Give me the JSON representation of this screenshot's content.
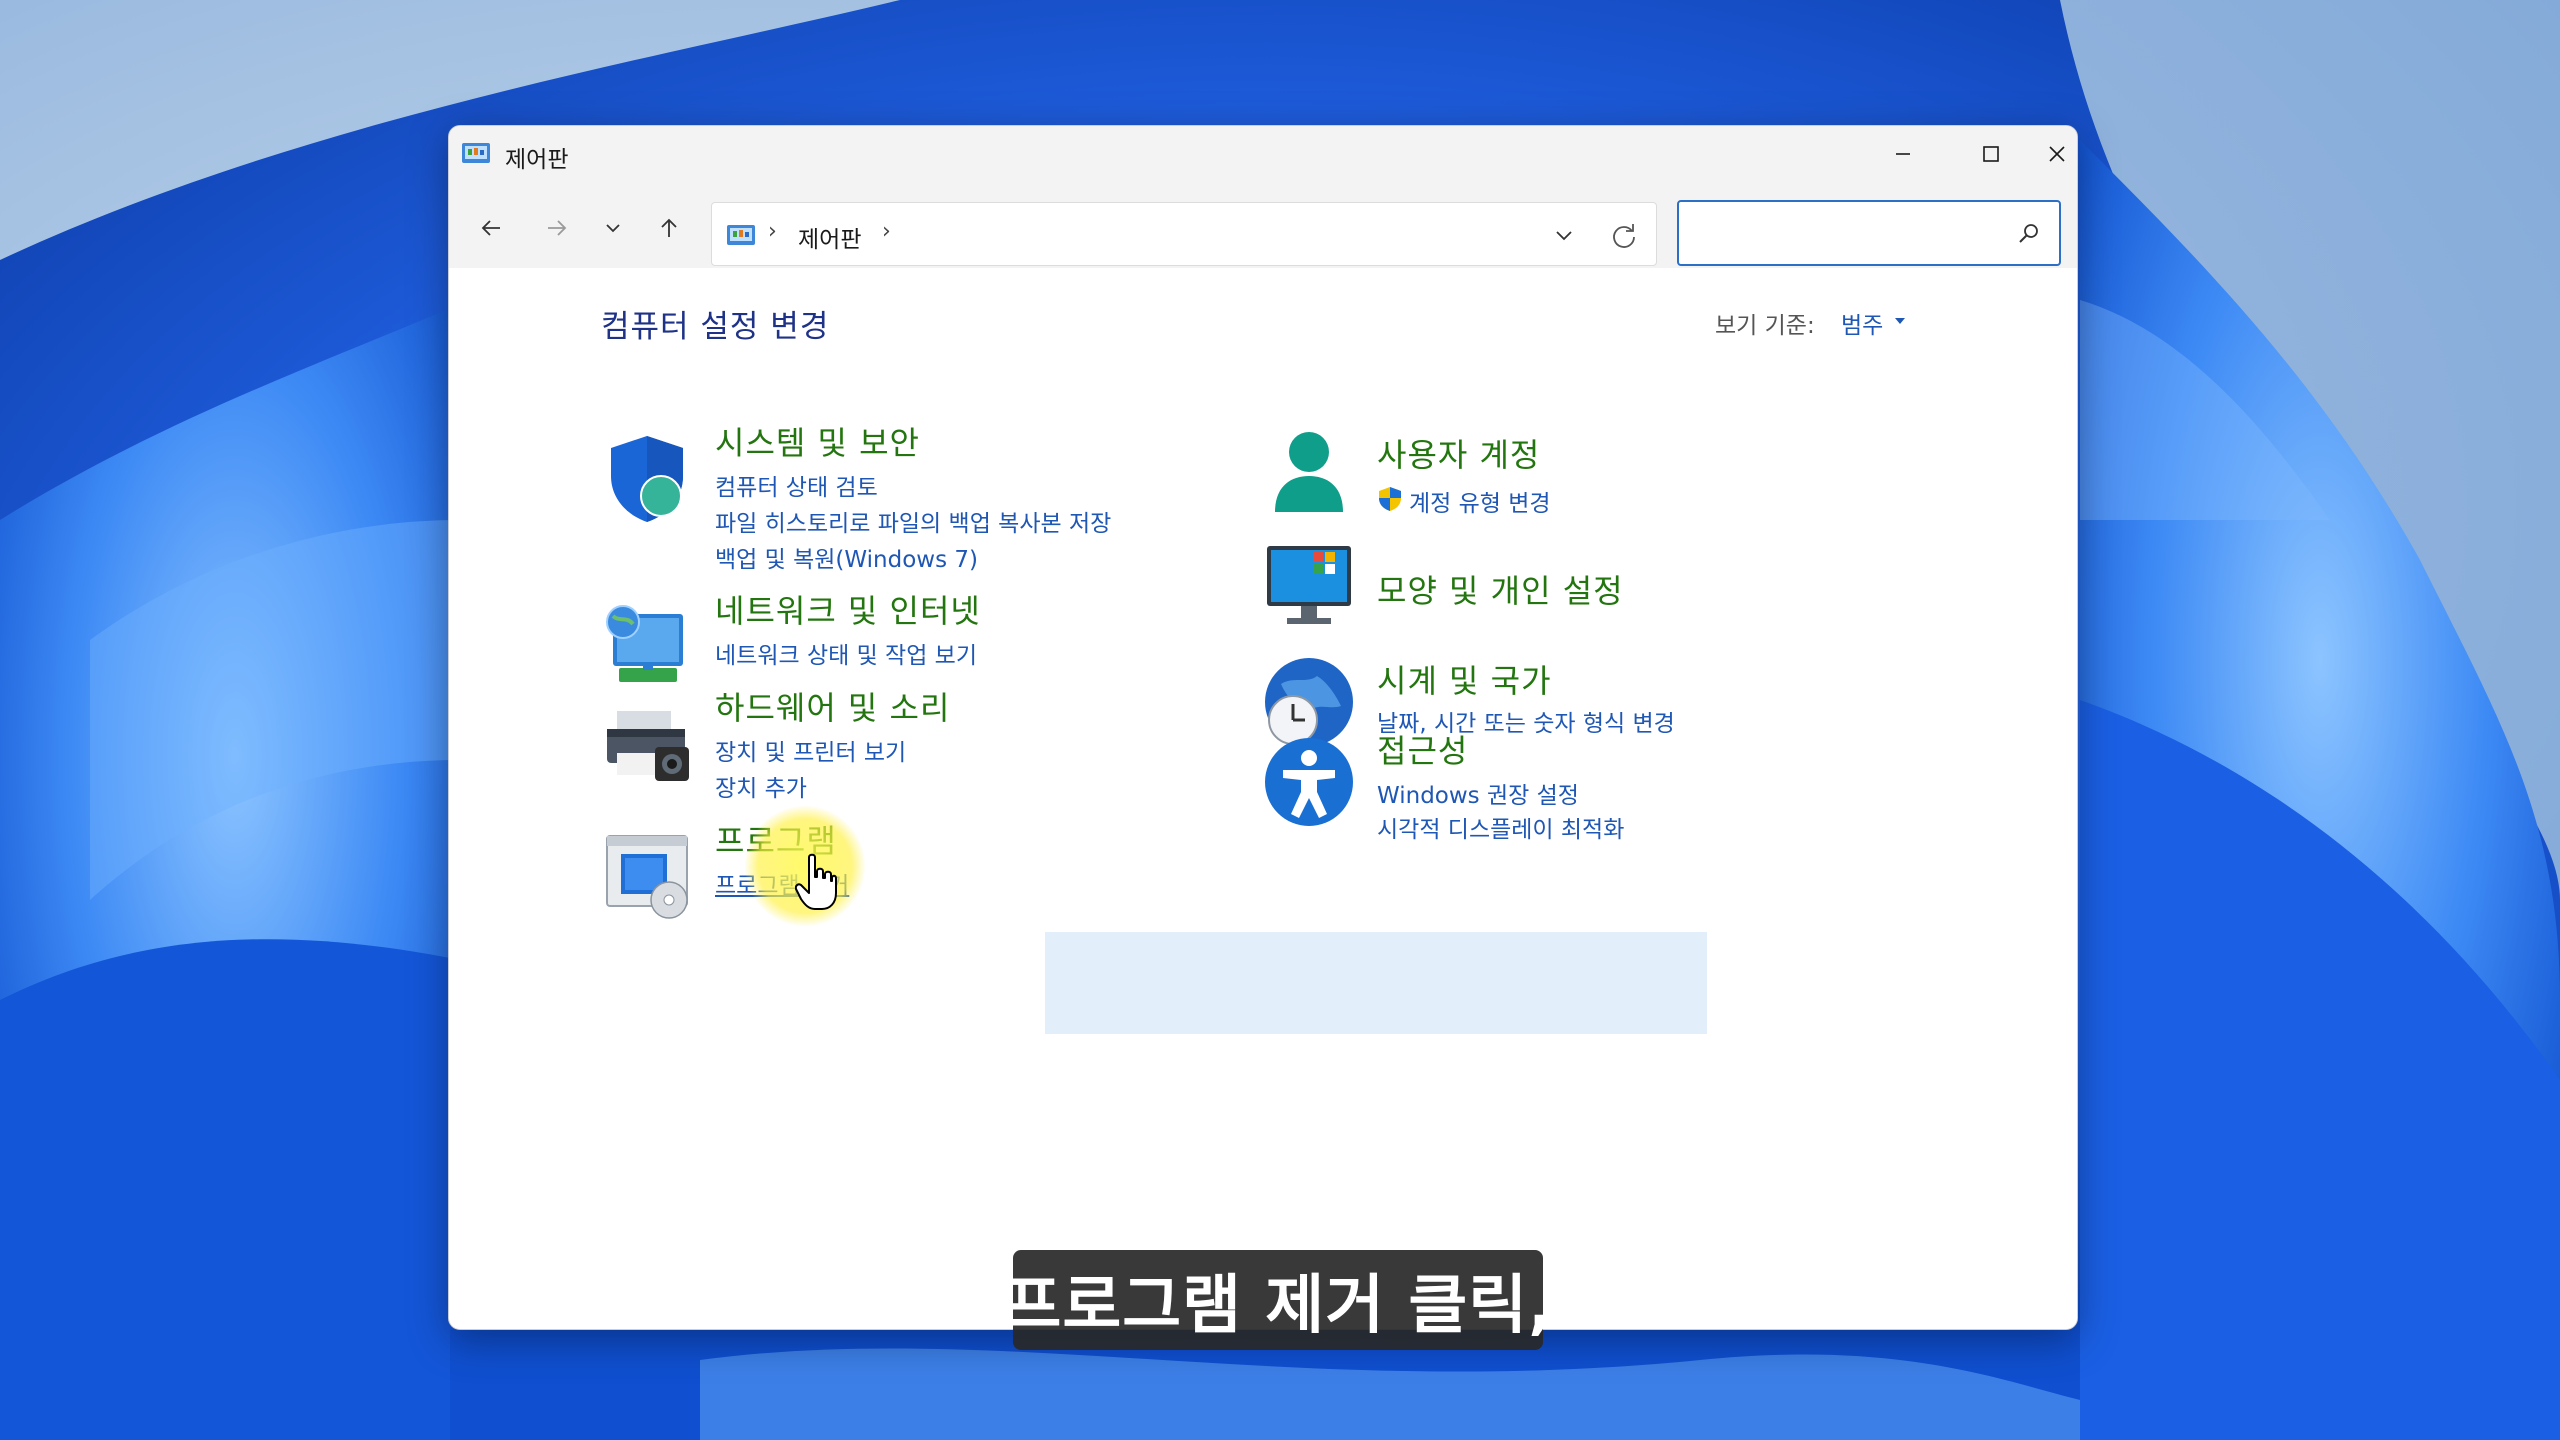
{
  "window": {
    "title": "제어판",
    "minimize_icon": "minimize-icon",
    "maximize_icon": "maximize-icon",
    "close_icon": "close-icon"
  },
  "navigation": {
    "breadcrumb": [
      "제어판"
    ],
    "search_placeholder": "",
    "search_value": ""
  },
  "content": {
    "title": "컴퓨터 설정 변경",
    "view_by_label": "보기 기준:",
    "view_by_value": "범주",
    "left_categories": [
      {
        "title": "시스템 및 보안",
        "links": [
          "컴퓨터 상태 검토",
          "파일 히스토리로 파일의 백업 복사본 저장",
          "백업 및 복원(Windows 7)"
        ]
      },
      {
        "title": "네트워크 및 인터넷",
        "links": [
          "네트워크 상태 및 작업 보기"
        ]
      },
      {
        "title": "하드웨어 및 소리",
        "links": [
          "장치 및 프린터 보기",
          "장치 추가"
        ]
      },
      {
        "title": "프로그램",
        "links": [
          "프로그램 제거"
        ]
      }
    ],
    "right_categories": [
      {
        "title": "사용자 계정",
        "links": [
          "계정 유형 변경"
        ]
      },
      {
        "title": "모양 및 개인 설정",
        "links": []
      },
      {
        "title": "시계 및 국가",
        "links": [
          "날짜, 시간 또는 숫자 형식 변경"
        ]
      },
      {
        "title": "접근성",
        "links": [
          "Windows 권장 설정",
          "시각적 디스플레이 최적화"
        ]
      }
    ]
  },
  "caption": "프로그램 제거 클릭,",
  "colors": {
    "category_title": "#23750f",
    "link": "#1f57b4",
    "page_title": "#1e3287",
    "hover_bg": "#e3eefb"
  }
}
